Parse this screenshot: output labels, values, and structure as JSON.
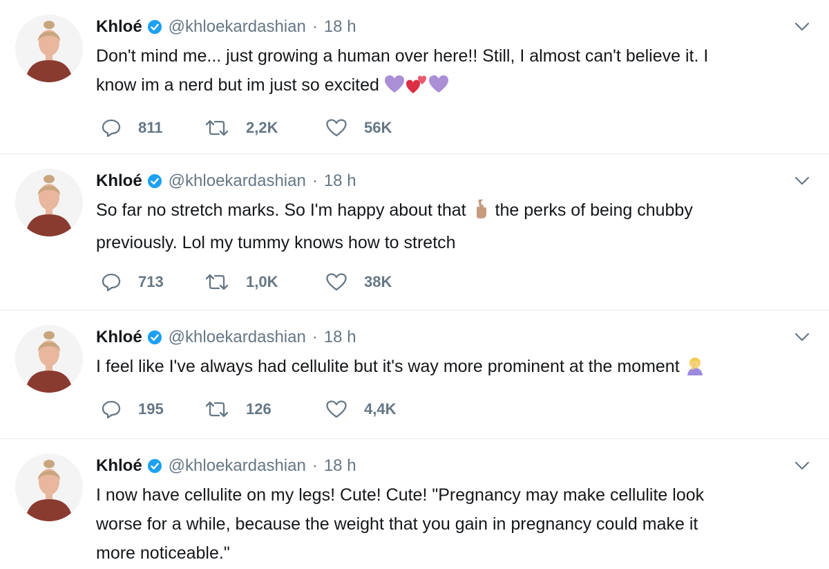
{
  "tweets": [
    {
      "name": "Khloé",
      "handle": "@khloekardashian",
      "separator": "·",
      "time": "18 h",
      "text_lines": [
        "Don't mind me... just growing a human over here!! Still, I almost can't believe it. I",
        "know im a nerd but im just so excited"
      ],
      "trailing_emoji": [
        "purple-heart",
        "two-hearts",
        "purple-heart"
      ],
      "replies": "811",
      "retweets": "2,2K",
      "likes": "56K"
    },
    {
      "name": "Khloé",
      "handle": "@khloekardashian",
      "separator": "·",
      "time": "18 h",
      "text_a": "So far no stretch marks. So I'm happy about that",
      "text_b": "the perks of being chubby",
      "text_line2": "previously. Lol my tummy knows how to stretch",
      "inline_emoji": "fingers-crossed",
      "replies": "713",
      "retweets": "1,0K",
      "likes": "38K"
    },
    {
      "name": "Khloé",
      "handle": "@khloekardashian",
      "separator": "·",
      "time": "18 h",
      "text": "I feel like I've always had cellulite but it's way more prominent at the moment",
      "trailing_emoji": "woman-facepalming",
      "replies": "195",
      "retweets": "126",
      "likes": "4,4K"
    },
    {
      "name": "Khloé",
      "handle": "@khloekardashian",
      "separator": "·",
      "time": "18 h",
      "text_lines": [
        "I now have cellulite on my legs! Cute! Cute! \"Pregnancy may make cellulite look",
        "worse for a while, because the weight that you gain in pregnancy could make it",
        "more noticeable.\""
      ]
    }
  ],
  "colors": {
    "text": "#14171a",
    "secondary": "#657786",
    "verified": "#1da1f2",
    "divider": "#e6ecf0"
  }
}
